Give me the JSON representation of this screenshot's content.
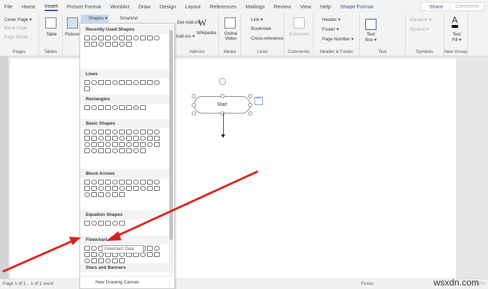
{
  "tabs": [
    "File",
    "Home",
    "Insert",
    "Picture Format",
    "WordArt",
    "Draw",
    "Design",
    "Layout",
    "References",
    "Mailings",
    "Review",
    "View",
    "Help",
    "Shape Format"
  ],
  "share": "Share",
  "comments": "Comments",
  "ribbon": {
    "pages": {
      "items": [
        "Cover Page ▾",
        "Blank Page",
        "Page Break"
      ],
      "label": "Pages"
    },
    "tables": {
      "button": "Table",
      "label": "Tables"
    },
    "pictures": "Pictures",
    "shapes": "Shapes ▾",
    "smartart": "SmartArt",
    "addins": {
      "get": "Get Add-ins",
      "my": "Add-ins ▾",
      "wikipedia": "Wikipedia",
      "label": "Add-ins"
    },
    "media": {
      "button": "Online Video",
      "label": "Media"
    },
    "links": {
      "items": [
        "Link ▾",
        "Bookmark",
        "Cross-reference"
      ],
      "label": "Links"
    },
    "comments": {
      "button": "Comment",
      "label": "Comments"
    },
    "header_footer": {
      "items": [
        "Header ▾",
        "Footer ▾",
        "Page Number ▾"
      ],
      "label": "Header & Footer"
    },
    "text": {
      "button": "Text Box ▾",
      "label": "Text"
    },
    "symbols": {
      "items": [
        "Equation ▾",
        "Symbol ▾"
      ],
      "label": "Symbols"
    },
    "newgroup": {
      "button": "Text Fill ▾",
      "label": "New Group"
    }
  },
  "panel": {
    "sections": [
      {
        "title": "Recently Used Shapes",
        "count": 18
      },
      {
        "title": "Lines",
        "count": 12
      },
      {
        "title": "Rectangles",
        "count": 9
      },
      {
        "title": "Basic Shapes",
        "count": 42
      },
      {
        "title": "Block Arrows",
        "count": 28
      },
      {
        "title": "Equation Shapes",
        "count": 6
      },
      {
        "title": "Flowchart",
        "count": 28
      },
      {
        "title": "Stars and Banners",
        "count": 0
      }
    ],
    "tooltip": "Flowchart: Data",
    "new_canvas": "New Drawing Canvas"
  },
  "document": {
    "shape_text": "Start"
  },
  "status": {
    "page": "Page 1 of 1",
    "words": "1 of 1 word",
    "focus": "Focus",
    "zoom": "100%"
  },
  "watermark": "wsxdn.com",
  "colors": {
    "accent": "#2b579a",
    "arrow": "#d9221c"
  }
}
